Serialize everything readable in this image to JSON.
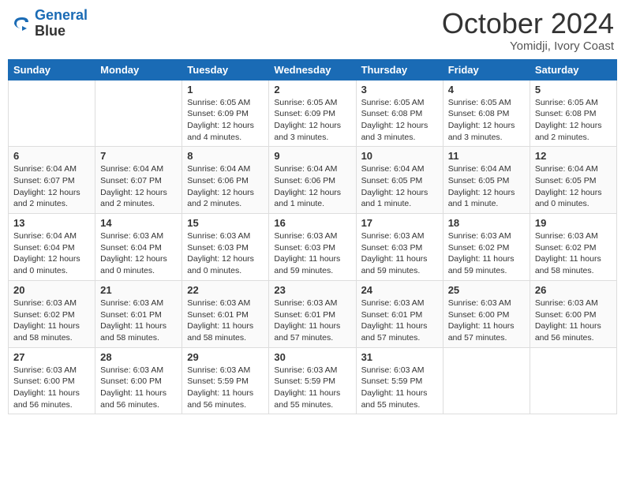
{
  "header": {
    "logo_line1": "General",
    "logo_line2": "Blue",
    "month": "October 2024",
    "location": "Yomidji, Ivory Coast"
  },
  "days_of_week": [
    "Sunday",
    "Monday",
    "Tuesday",
    "Wednesday",
    "Thursday",
    "Friday",
    "Saturday"
  ],
  "weeks": [
    [
      {
        "num": "",
        "info": ""
      },
      {
        "num": "",
        "info": ""
      },
      {
        "num": "1",
        "info": "Sunrise: 6:05 AM\nSunset: 6:09 PM\nDaylight: 12 hours and 4 minutes."
      },
      {
        "num": "2",
        "info": "Sunrise: 6:05 AM\nSunset: 6:09 PM\nDaylight: 12 hours and 3 minutes."
      },
      {
        "num": "3",
        "info": "Sunrise: 6:05 AM\nSunset: 6:08 PM\nDaylight: 12 hours and 3 minutes."
      },
      {
        "num": "4",
        "info": "Sunrise: 6:05 AM\nSunset: 6:08 PM\nDaylight: 12 hours and 3 minutes."
      },
      {
        "num": "5",
        "info": "Sunrise: 6:05 AM\nSunset: 6:08 PM\nDaylight: 12 hours and 2 minutes."
      }
    ],
    [
      {
        "num": "6",
        "info": "Sunrise: 6:04 AM\nSunset: 6:07 PM\nDaylight: 12 hours and 2 minutes."
      },
      {
        "num": "7",
        "info": "Sunrise: 6:04 AM\nSunset: 6:07 PM\nDaylight: 12 hours and 2 minutes."
      },
      {
        "num": "8",
        "info": "Sunrise: 6:04 AM\nSunset: 6:06 PM\nDaylight: 12 hours and 2 minutes."
      },
      {
        "num": "9",
        "info": "Sunrise: 6:04 AM\nSunset: 6:06 PM\nDaylight: 12 hours and 1 minute."
      },
      {
        "num": "10",
        "info": "Sunrise: 6:04 AM\nSunset: 6:05 PM\nDaylight: 12 hours and 1 minute."
      },
      {
        "num": "11",
        "info": "Sunrise: 6:04 AM\nSunset: 6:05 PM\nDaylight: 12 hours and 1 minute."
      },
      {
        "num": "12",
        "info": "Sunrise: 6:04 AM\nSunset: 6:05 PM\nDaylight: 12 hours and 0 minutes."
      }
    ],
    [
      {
        "num": "13",
        "info": "Sunrise: 6:04 AM\nSunset: 6:04 PM\nDaylight: 12 hours and 0 minutes."
      },
      {
        "num": "14",
        "info": "Sunrise: 6:03 AM\nSunset: 6:04 PM\nDaylight: 12 hours and 0 minutes."
      },
      {
        "num": "15",
        "info": "Sunrise: 6:03 AM\nSunset: 6:03 PM\nDaylight: 12 hours and 0 minutes."
      },
      {
        "num": "16",
        "info": "Sunrise: 6:03 AM\nSunset: 6:03 PM\nDaylight: 11 hours and 59 minutes."
      },
      {
        "num": "17",
        "info": "Sunrise: 6:03 AM\nSunset: 6:03 PM\nDaylight: 11 hours and 59 minutes."
      },
      {
        "num": "18",
        "info": "Sunrise: 6:03 AM\nSunset: 6:02 PM\nDaylight: 11 hours and 59 minutes."
      },
      {
        "num": "19",
        "info": "Sunrise: 6:03 AM\nSunset: 6:02 PM\nDaylight: 11 hours and 58 minutes."
      }
    ],
    [
      {
        "num": "20",
        "info": "Sunrise: 6:03 AM\nSunset: 6:02 PM\nDaylight: 11 hours and 58 minutes."
      },
      {
        "num": "21",
        "info": "Sunrise: 6:03 AM\nSunset: 6:01 PM\nDaylight: 11 hours and 58 minutes."
      },
      {
        "num": "22",
        "info": "Sunrise: 6:03 AM\nSunset: 6:01 PM\nDaylight: 11 hours and 58 minutes."
      },
      {
        "num": "23",
        "info": "Sunrise: 6:03 AM\nSunset: 6:01 PM\nDaylight: 11 hours and 57 minutes."
      },
      {
        "num": "24",
        "info": "Sunrise: 6:03 AM\nSunset: 6:01 PM\nDaylight: 11 hours and 57 minutes."
      },
      {
        "num": "25",
        "info": "Sunrise: 6:03 AM\nSunset: 6:00 PM\nDaylight: 11 hours and 57 minutes."
      },
      {
        "num": "26",
        "info": "Sunrise: 6:03 AM\nSunset: 6:00 PM\nDaylight: 11 hours and 56 minutes."
      }
    ],
    [
      {
        "num": "27",
        "info": "Sunrise: 6:03 AM\nSunset: 6:00 PM\nDaylight: 11 hours and 56 minutes."
      },
      {
        "num": "28",
        "info": "Sunrise: 6:03 AM\nSunset: 6:00 PM\nDaylight: 11 hours and 56 minutes."
      },
      {
        "num": "29",
        "info": "Sunrise: 6:03 AM\nSunset: 5:59 PM\nDaylight: 11 hours and 56 minutes."
      },
      {
        "num": "30",
        "info": "Sunrise: 6:03 AM\nSunset: 5:59 PM\nDaylight: 11 hours and 55 minutes."
      },
      {
        "num": "31",
        "info": "Sunrise: 6:03 AM\nSunset: 5:59 PM\nDaylight: 11 hours and 55 minutes."
      },
      {
        "num": "",
        "info": ""
      },
      {
        "num": "",
        "info": ""
      }
    ]
  ]
}
